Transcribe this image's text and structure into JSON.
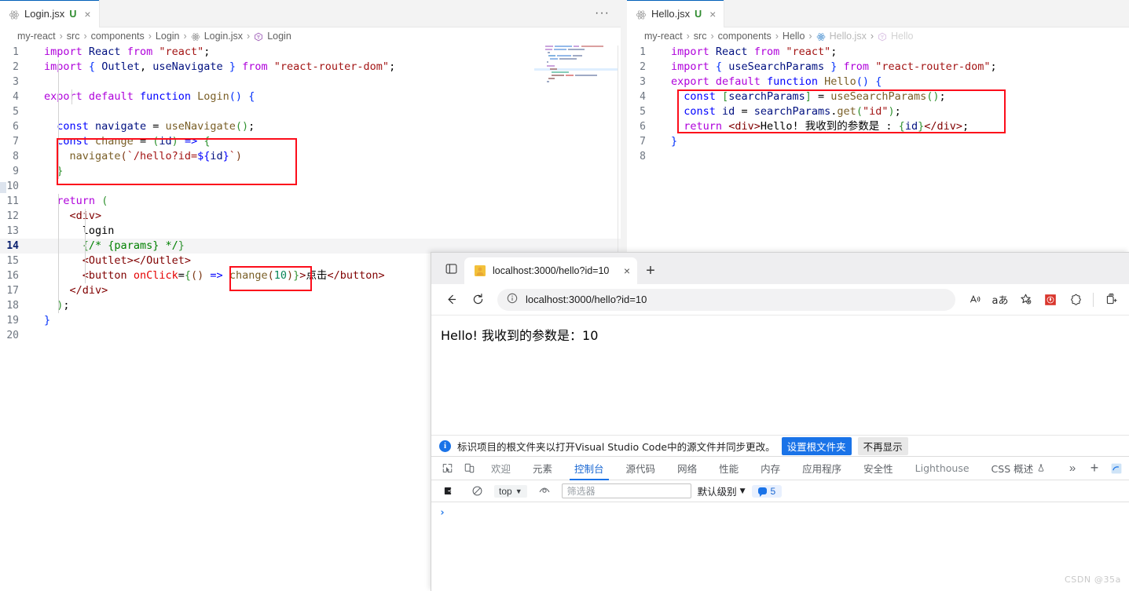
{
  "editor_left": {
    "tab": {
      "filename": "Login.jsx",
      "status_badge": "U",
      "icon": "react-icon",
      "close": "×"
    },
    "tab_actions": "···",
    "breadcrumb": [
      "my-react",
      "src",
      "components",
      "Login",
      "Login.jsx",
      "Login"
    ],
    "breadcrumb_sep": "›",
    "line_numbers": [
      1,
      2,
      3,
      4,
      5,
      6,
      7,
      8,
      9,
      10,
      11,
      12,
      13,
      14,
      15,
      16,
      17,
      18,
      19,
      20
    ],
    "code_lines": [
      "import React from \"react\";",
      "import { Outlet, useNavigate } from \"react-router-dom\";",
      "",
      "export default function Login() {",
      "",
      "  const navigate = useNavigate();",
      "  const change = (id) => {",
      "    navigate(`/hello?id=${id}`)",
      "  }",
      "",
      "  return (",
      "    <div>",
      "      login",
      "      {/* {params} */}",
      "      <Outlet></Outlet>",
      "      <button onClick={() => change(10)}>点击</button>",
      "    </div>",
      "  );",
      "}",
      ""
    ],
    "highlight_boxes": [
      "const change arrow function block",
      "change(10) call"
    ]
  },
  "editor_right": {
    "tab": {
      "filename": "Hello.jsx",
      "status_badge": "U",
      "icon": "react-icon",
      "close": "×"
    },
    "breadcrumb": [
      "my-react",
      "src",
      "components",
      "Hello",
      "Hello.jsx",
      "Hello"
    ],
    "breadcrumb_sep": "›",
    "line_numbers": [
      1,
      2,
      3,
      4,
      5,
      6,
      7,
      8
    ],
    "code_lines": [
      "import React from \"react\";",
      "import { useSearchParams } from \"react-router-dom\";",
      "export default function Hello() {",
      "  const [searchParams] = useSearchParams();",
      "  const id = searchParams.get(\"id\");",
      "  return <div>Hello! 我收到的参数是 : {id}</div>;",
      "}",
      ""
    ],
    "highlight_boxes": [
      "useSearchParams block lines 4-6"
    ]
  },
  "browser": {
    "tab": {
      "title": "localhost:3000/hello?id=10",
      "favicon": "react-dev-favicon",
      "close": "×"
    },
    "new_tab_label": "+",
    "toolbar": {
      "back": "←",
      "reload": "⟳",
      "info_icon": "info-icon",
      "url": "localhost:3000/hello?id=10",
      "read_aloud": "Aⁿ",
      "translate": "aあ",
      "favorites": "☆",
      "extension": "extension-icon",
      "settings": "settings-icon",
      "collections": "collections-icon"
    },
    "page": {
      "text": "Hello! 我收到的参数是：10"
    },
    "notification": {
      "message": "标识项目的根文件夹以打开Visual Studio Code中的源文件并同步更改。",
      "primary_button": "设置根文件夹",
      "secondary_button": "不再显示",
      "icon": "info-icon"
    }
  },
  "devtools": {
    "tabs": [
      {
        "label": "欢迎",
        "active": false
      },
      {
        "label": "元素",
        "active": false
      },
      {
        "label": "控制台",
        "active": true
      },
      {
        "label": "源代码",
        "active": false
      },
      {
        "label": "网络",
        "active": false
      },
      {
        "label": "性能",
        "active": false
      },
      {
        "label": "内存",
        "active": false
      },
      {
        "label": "应用程序",
        "active": false
      },
      {
        "label": "安全性",
        "active": false
      },
      {
        "label": "Lighthouse",
        "active": false
      },
      {
        "label": "CSS 概述",
        "active": false
      }
    ],
    "overflow": "»",
    "add_tab": "+",
    "console_toolbar": {
      "clear_icon": "clear-console-icon",
      "context": "top",
      "eye_icon": "live-expression-icon",
      "filter_placeholder": "筛选器",
      "level": "默认级别",
      "message_count": "5"
    },
    "console_prompt": "›"
  },
  "watermark": "CSDN @35a",
  "colors": {
    "vscode_tabbar": "#f3f3f3",
    "accent_blue": "#005fb8",
    "highlight_red": "#fc0d1b",
    "devtools_active": "#1a73e8",
    "badge_green": "#2e8b2e"
  }
}
